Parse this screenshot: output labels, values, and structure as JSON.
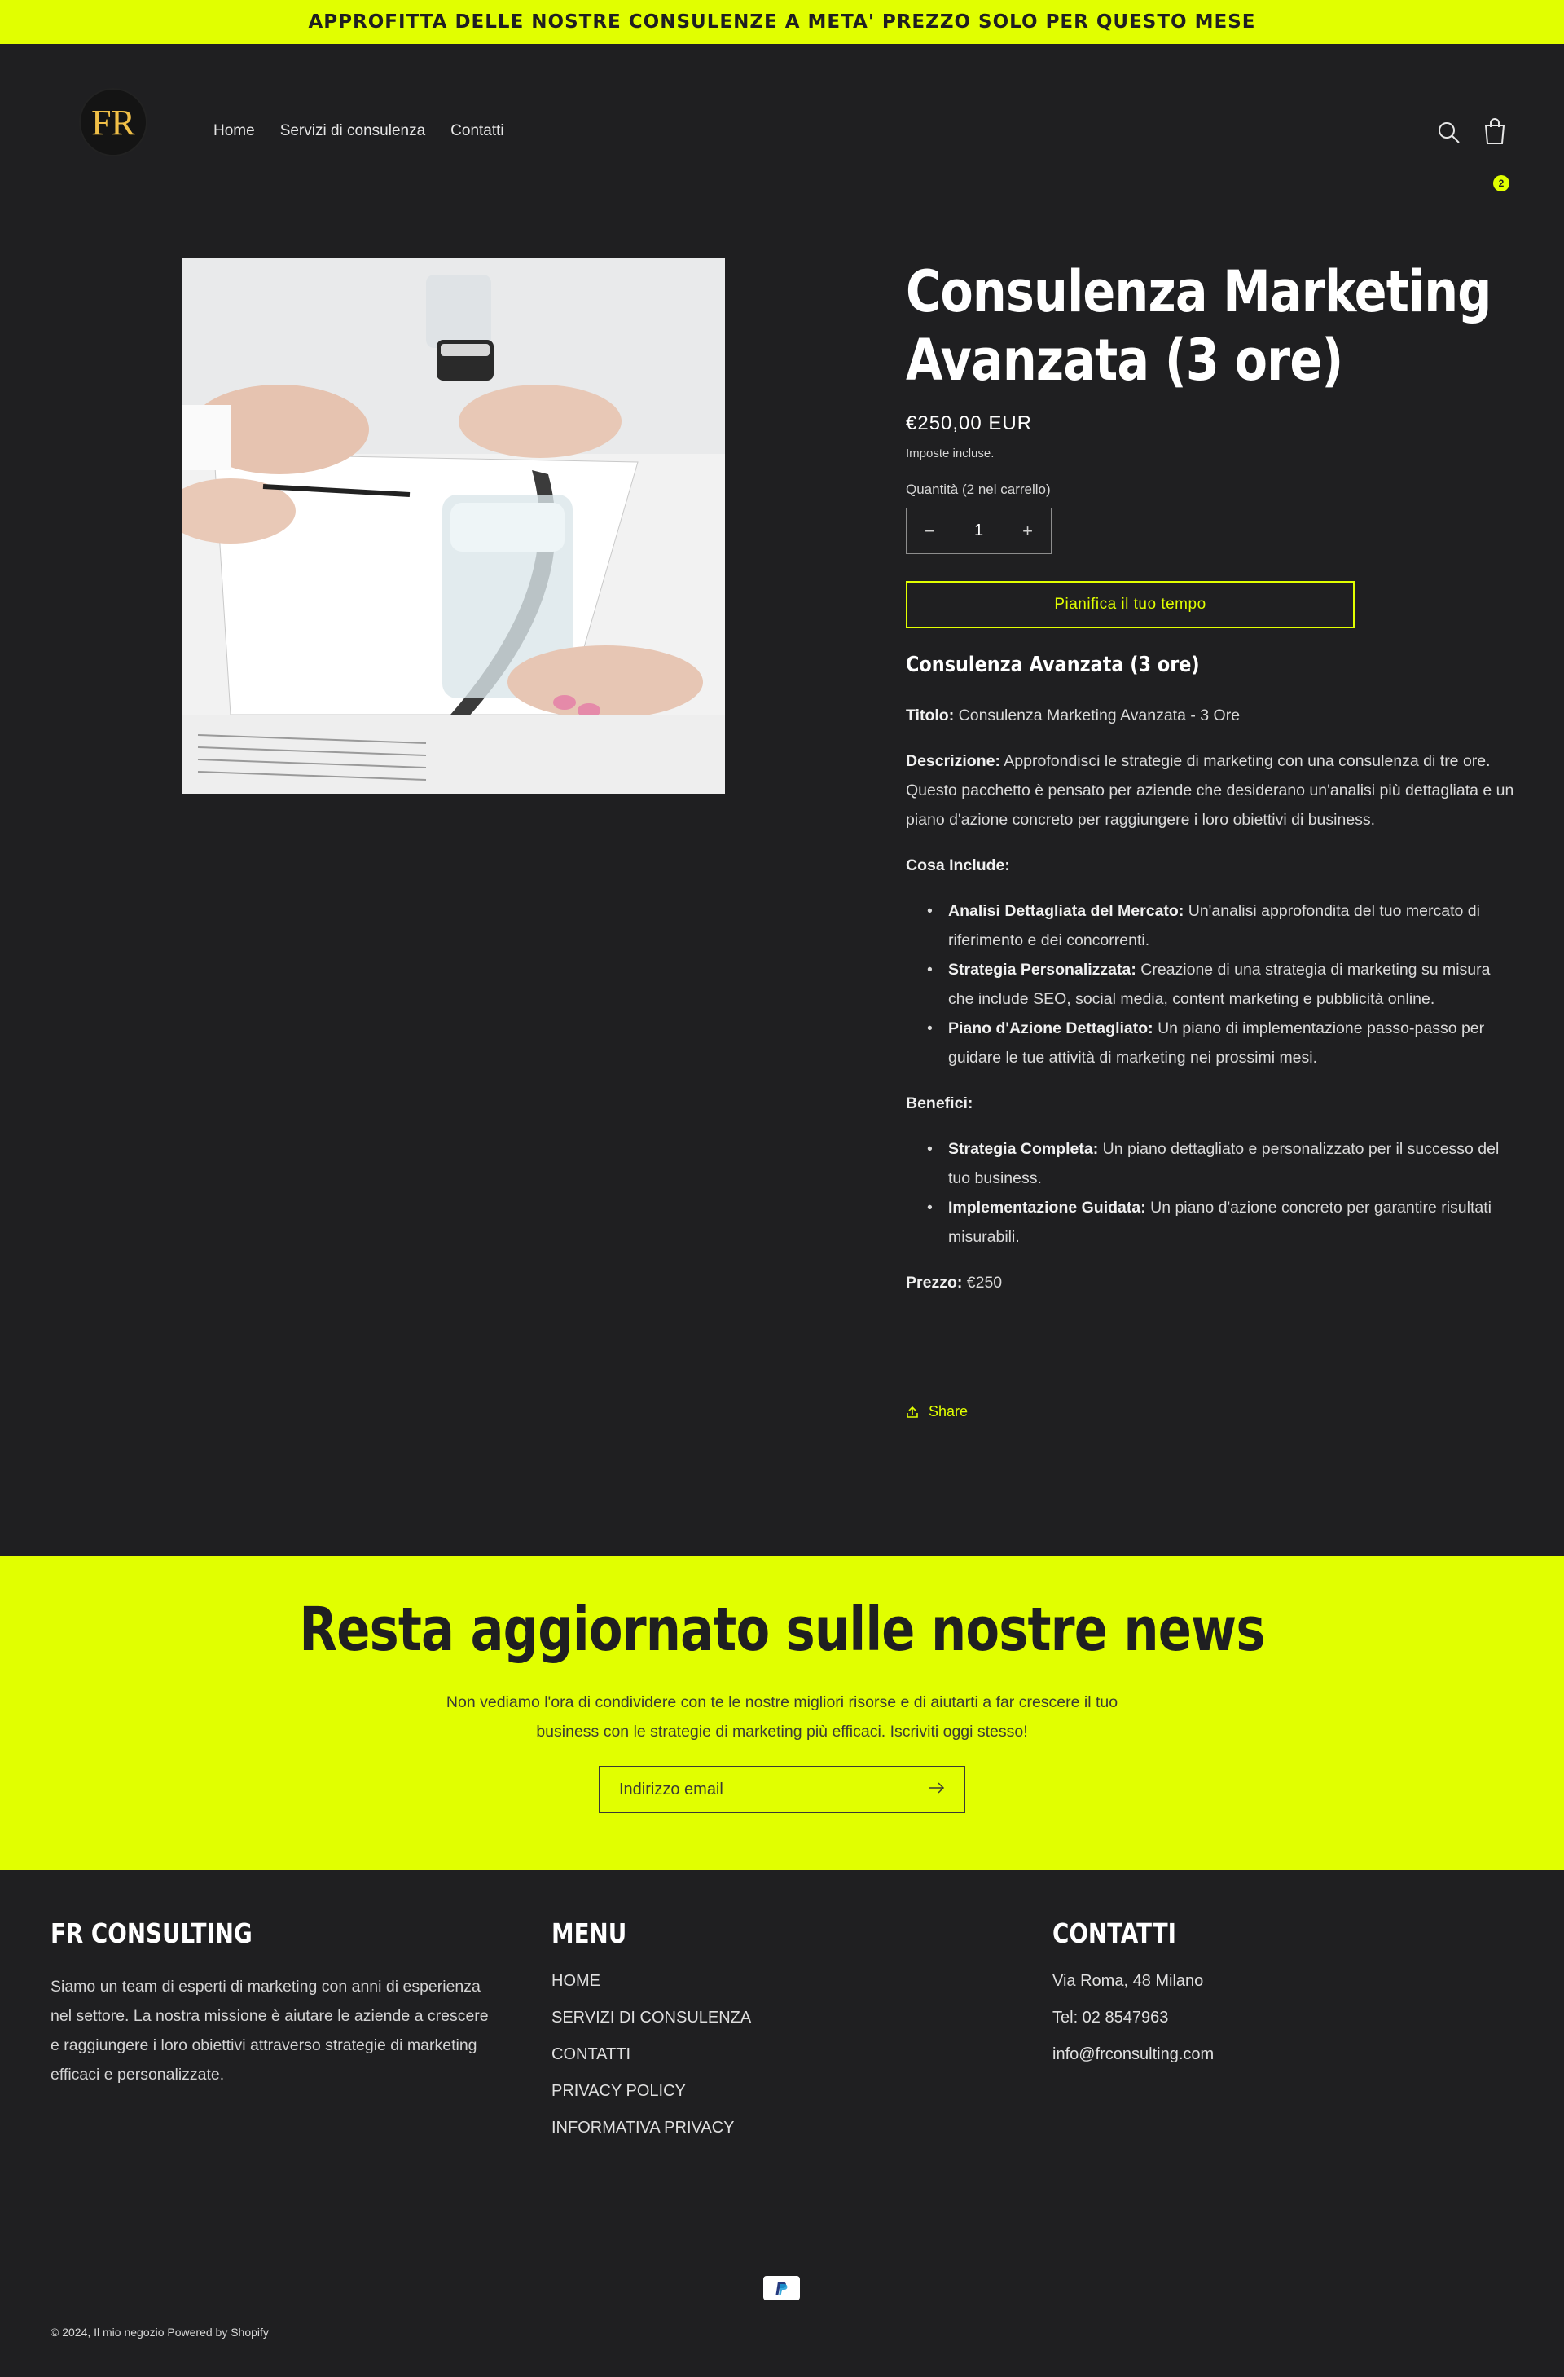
{
  "announcement": "APPROFITTA DELLE NOSTRE CONSULENZE A META' PREZZO SOLO PER QUESTO MESE",
  "header": {
    "logo_text": "FR",
    "nav": [
      "Home",
      "Servizi di consulenza",
      "Contatti"
    ],
    "cart_count": "2"
  },
  "product": {
    "title": "Consulenza Marketing Avanzata (3 ore)",
    "price": "€250,00 EUR",
    "tax_note": "Imposte incluse.",
    "quantity_label": "Quantità (2 nel carrello)",
    "quantity": "1",
    "cta": "Pianifica il tuo tempo",
    "share": "Share",
    "description": {
      "heading": "Consulenza Avanzata (3 ore)",
      "title_label": "Titolo:",
      "title_value": " Consulenza Marketing Avanzata - 3 Ore",
      "desc_label": "Descrizione:",
      "desc_value": " Approfondisci le strategie di marketing con una consulenza di tre ore. Questo pacchetto è pensato per aziende che desiderano un'analisi più dettagliata e un piano d'azione concreto per raggiungere i loro obiettivi di business.",
      "includes_label": "Cosa Include:",
      "includes": [
        {
          "label": "Analisi Dettagliata del Mercato:",
          "text": " Un'analisi approfondita del tuo mercato di riferimento e dei concorrenti."
        },
        {
          "label": "Strategia Personalizzata:",
          "text": " Creazione di una strategia di marketing su misura che include SEO, social media, content marketing e pubblicità online."
        },
        {
          "label": "Piano d'Azione Dettagliato:",
          "text": " Un piano di implementazione passo-passo per guidare le tue attività di marketing nei prossimi mesi."
        }
      ],
      "benefits_label": "Benefici:",
      "benefits": [
        {
          "label": "Strategia Completa:",
          "text": " Un piano dettagliato e personalizzato per il successo del tuo business."
        },
        {
          "label": "Implementazione Guidata:",
          "text": " Un piano d'azione concreto per garantire risultati misurabili."
        }
      ],
      "price_label": "Prezzo:",
      "price_value": " €250"
    }
  },
  "newsletter": {
    "title": "Resta aggiornato sulle nostre news",
    "text": "Non vediamo l'ora di condividere con te le nostre migliori risorse e di aiutarti a far crescere il tuo business con le strategie di marketing più efficaci. Iscriviti oggi stesso!",
    "placeholder": "Indirizzo email"
  },
  "footer": {
    "about_title": "FR CONSULTING",
    "about_text": "Siamo un team di esperti di marketing con anni di esperienza nel settore. La nostra missione è aiutare le aziende a crescere e raggiungere i loro obiettivi attraverso strategie di marketing efficaci e personalizzate.",
    "menu_title": "MENU",
    "menu": [
      "HOME",
      "SERVIZI DI CONSULENZA",
      "CONTATTI",
      "PRIVACY POLICY",
      "INFORMATIVA PRIVACY"
    ],
    "contacts_title": "CONTATTI",
    "contacts": [
      "Via Roma, 48 Milano",
      "Tel: 02 8547963",
      "info@frconsulting.com"
    ],
    "payment_icon": "paypal-icon",
    "copyright": "© 2024, Il mio negozio Powered by Shopify"
  },
  "colors": {
    "accent": "#e1ff00",
    "background": "#1f1f21",
    "logo_gold": "#f0bf47"
  }
}
